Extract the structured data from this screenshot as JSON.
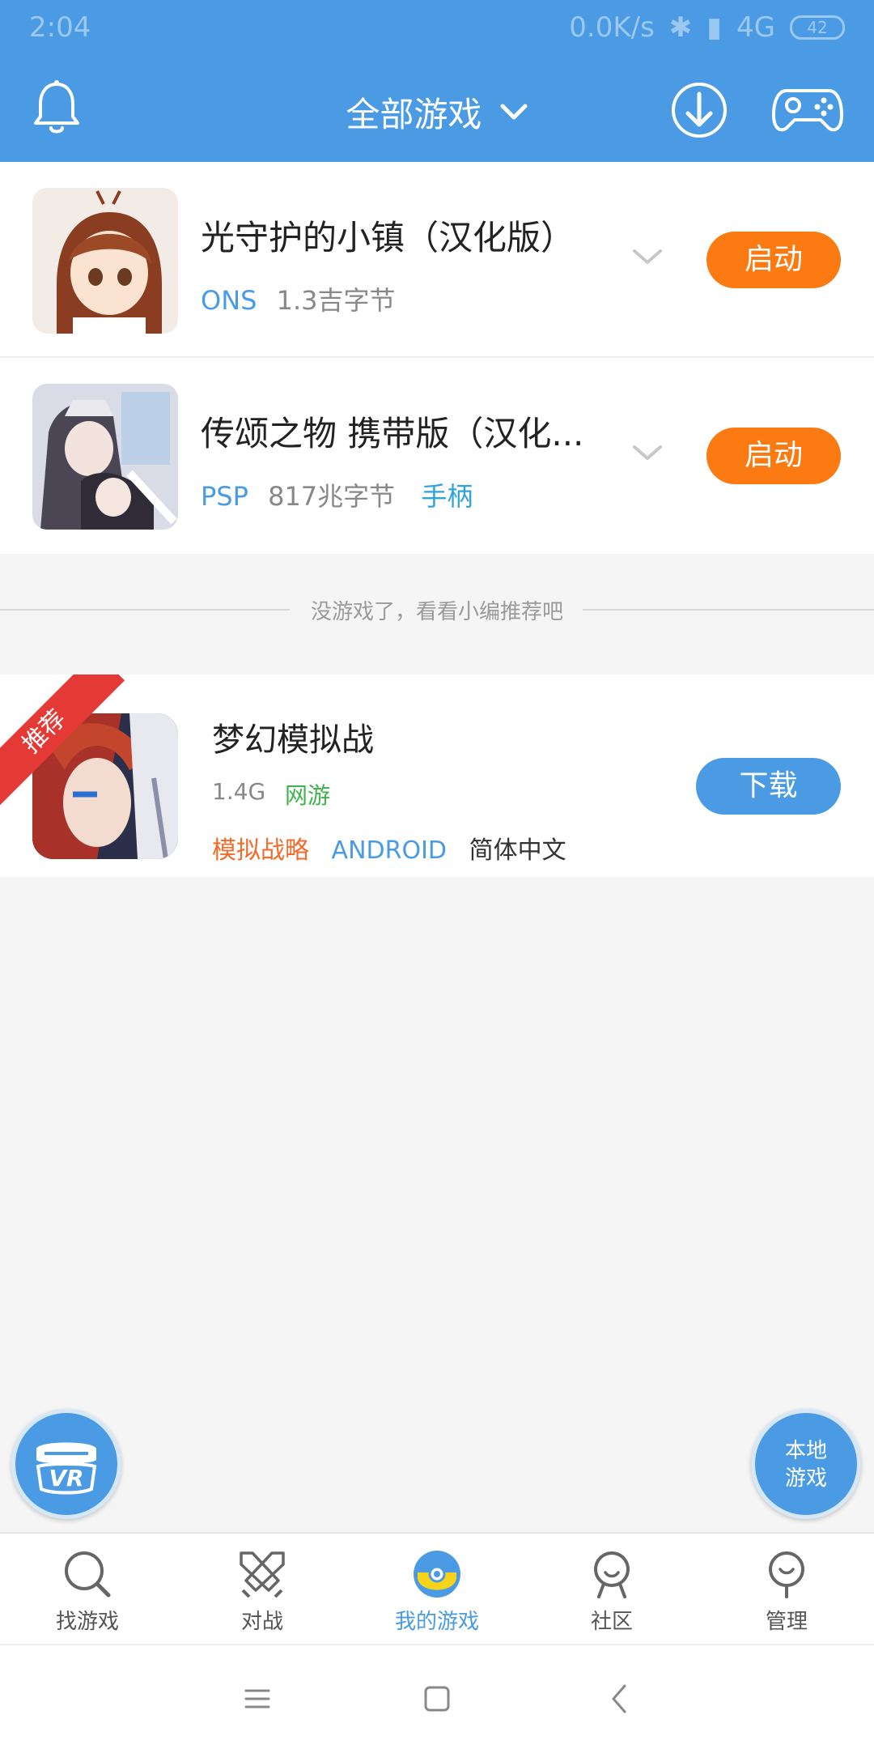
{
  "status_bar": {
    "time": "2:04",
    "net_speed": "0.0K/s",
    "network": "4G",
    "battery": "42"
  },
  "header": {
    "title": "全部游戏",
    "icons": {
      "left": "bell-icon",
      "download": "download-icon",
      "gamepad": "gamepad-icon"
    }
  },
  "games": [
    {
      "title": "光守护的小镇（汉化版）",
      "platform": "ONS",
      "size": "1.3吉字节",
      "tag": "",
      "action": "启动"
    },
    {
      "title": "传颂之物 携带版（汉化...",
      "platform": "PSP",
      "size": "817兆字节",
      "tag": "手柄",
      "action": "启动"
    }
  ],
  "divider_text": "没游戏了，看看小编推荐吧",
  "recommended": {
    "ribbon": "推荐",
    "title": "梦幻模拟战",
    "size": "1.4G",
    "type": "网游",
    "tags": [
      "模拟战略",
      "ANDROID",
      "简体中文"
    ],
    "action": "下载"
  },
  "fabs": {
    "vr": "VR",
    "local_line1": "本地",
    "local_line2": "游戏"
  },
  "tabs": [
    {
      "label": "找游戏",
      "icon": "search-icon"
    },
    {
      "label": "对战",
      "icon": "swords-icon"
    },
    {
      "label": "我的游戏",
      "icon": "my-games-icon"
    },
    {
      "label": "社区",
      "icon": "community-icon"
    },
    {
      "label": "管理",
      "icon": "manage-icon"
    }
  ],
  "colors": {
    "brand": "#4a9be4",
    "launch": "#fb7a12",
    "ribbon": "#e53935",
    "online_tag": "#3eb34a",
    "strategy_tag": "#f26b2a"
  }
}
